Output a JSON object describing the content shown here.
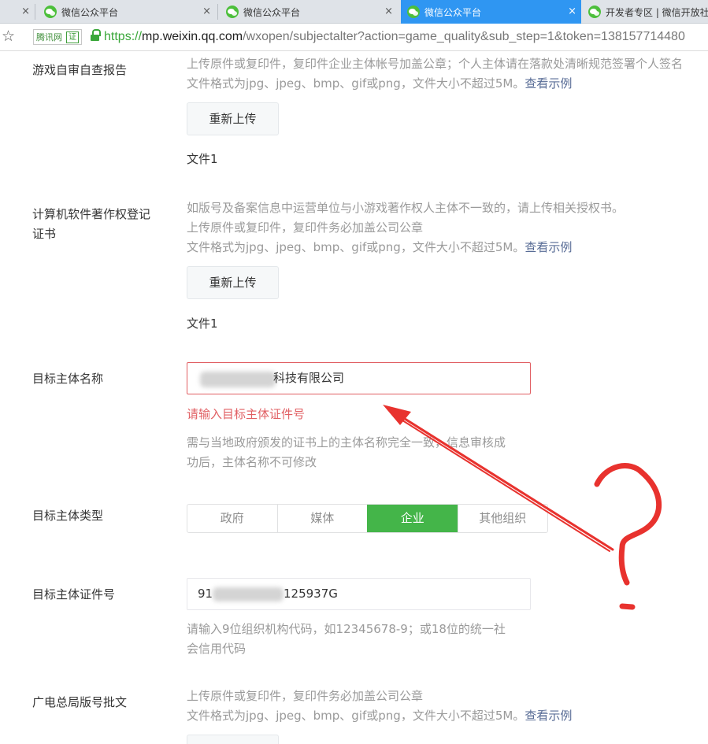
{
  "tabs": [
    {
      "label": "微信公众平台",
      "active": false
    },
    {
      "label": "微信公众平台",
      "active": false
    },
    {
      "label": "微信公众平台",
      "active": true
    },
    {
      "label": "开发者专区 | 微信开放社",
      "active": false
    }
  ],
  "close_glyph": "×",
  "address": {
    "site_badge": "腾讯网",
    "cert_badge": "证",
    "url_protocol": "https://",
    "url_host": "mp.weixin.qq.com",
    "url_path": "/wxopen/subjectalter?action=game_quality&sub_step=1&token=138157714480"
  },
  "form": {
    "self_check": {
      "label": "游戏自审自查报告",
      "desc1": "上传原件或复印件，复印件企业主体帐号加盖公章；个人主体请在落款处清晰规范签署个人签名",
      "desc2": "文件格式为jpg、jpeg、bmp、gif或png，文件大小不超过5M。",
      "example_link": "查看示例",
      "reupload": "重新上传",
      "file": "文件1"
    },
    "copyright": {
      "label_line1": "计算机软件著作权登记",
      "label_line2": "证书",
      "desc1": "如版号及备案信息中运营单位与小游戏著作权人主体不一致的，请上传相关授权书。",
      "desc2": "上传原件或复印件，复印件务必加盖公司公章",
      "desc3": "文件格式为jpg、jpeg、bmp、gif或png，文件大小不超过5M。",
      "example_link": "查看示例",
      "reupload": "重新上传",
      "file": "文件1"
    },
    "subject_name": {
      "label": "目标主体名称",
      "value": "科技有限公司",
      "error": "请输入目标主体证件号",
      "hint1": "需与当地政府颁发的证书上的主体名称完全一致，信息审核成",
      "hint2": "功后，主体名称不可修改"
    },
    "subject_type": {
      "label": "目标主体类型",
      "options": [
        "政府",
        "媒体",
        "企业",
        "其他组织"
      ],
      "selected": "企业"
    },
    "subject_id": {
      "label": "目标主体证件号",
      "value_prefix": "91",
      "value_suffix": "125937G",
      "hint1": "请输入9位组织机构代码，如12345678-9；或18位的统一社",
      "hint2": "会信用代码"
    },
    "approval": {
      "label": "广电总局版号批文",
      "desc1": "上传原件或复印件，复印件务必加盖公司公章",
      "desc2": "文件格式为jpg、jpeg、bmp、gif或png，文件大小不超过5M。",
      "example_link": "查看示例"
    }
  },
  "annotation": {
    "color": "#e8322e",
    "question_mark_shape": "?"
  }
}
